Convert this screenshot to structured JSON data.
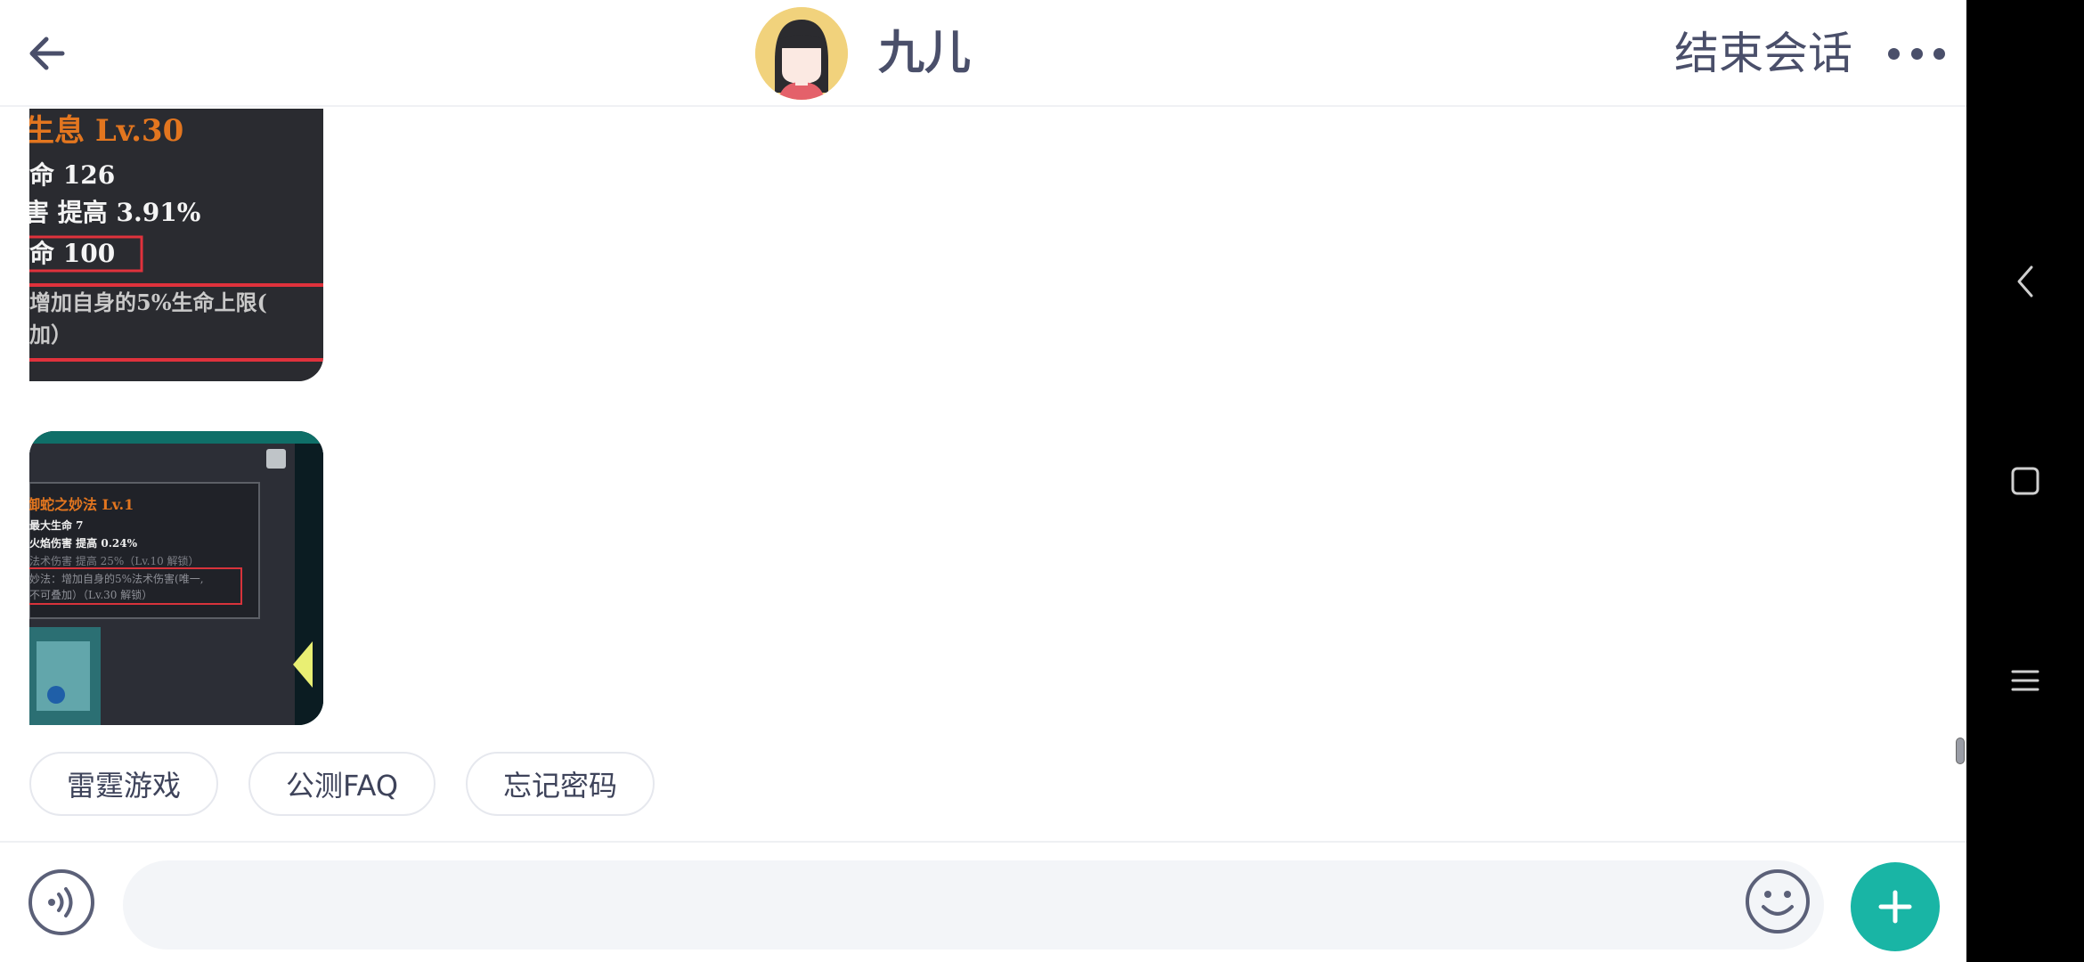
{
  "header": {
    "contact_name": "九儿",
    "end_session_label": "结束会话",
    "back_icon": "arrow-left-icon",
    "more_icon": "more-dots-icon"
  },
  "messages": [
    {
      "type": "image",
      "lines": [
        "生息 Lv.30",
        "命 126",
        "害 提高 3.91%",
        "命 100",
        "增加自身的5%生命上限(",
        "加）"
      ]
    },
    {
      "type": "image",
      "lines": [
        "御蛇之妙法 Lv.1",
        "最大生命 7",
        "火焰伤害 提高 0.24%",
        "法术伤害 提高 25%（Lv.10 解锁）",
        "妙法：增加自身的5%法术伤害(唯一,",
        "不可叠加）（Lv.30 解锁）"
      ]
    }
  ],
  "quick_replies": [
    "雷霆游戏",
    "公测FAQ",
    "忘记密码"
  ],
  "input": {
    "placeholder": "",
    "value": ""
  },
  "colors": {
    "accent": "#19b5a5",
    "text": "#4a4f6a",
    "chip_border": "#e6e8ee"
  }
}
